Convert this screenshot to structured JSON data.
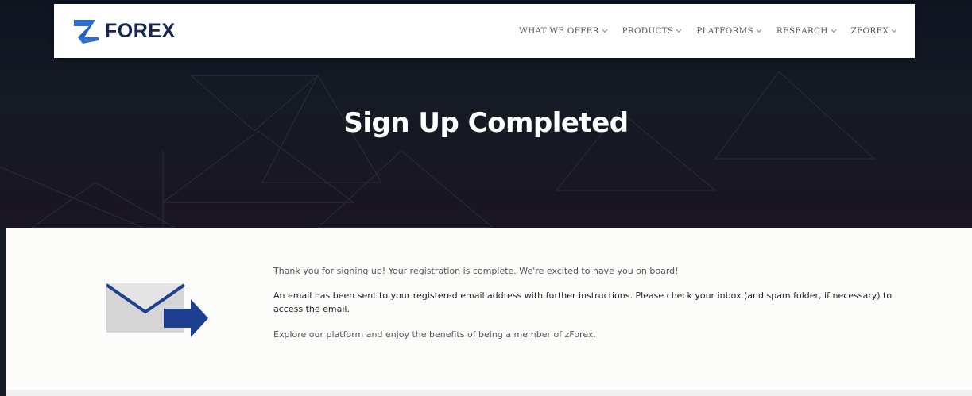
{
  "brand": {
    "logo_text": "FOREX",
    "logo_icon": "z-bolt-logo-icon",
    "colors": {
      "primary": "#16254f",
      "accent": "#1f5fbf"
    }
  },
  "nav": {
    "items": [
      {
        "label": "WHAT WE OFFER"
      },
      {
        "label": "PRODUCTS"
      },
      {
        "label": "PLATFORMS"
      },
      {
        "label": "RESEARCH"
      },
      {
        "label": "ZFOREX"
      }
    ]
  },
  "hero": {
    "title": "Sign Up Completed"
  },
  "message": {
    "icon": "email-sent-icon",
    "line1": "Thank you for signing up! Your registration is complete. We're excited to have you on board!",
    "line2": "An email has been sent to your registered email address with further instructions. Please check your inbox (and spam folder, if necessary) to access the email.",
    "line3": "Explore our platform and enjoy the benefits of being a member of zForex."
  }
}
